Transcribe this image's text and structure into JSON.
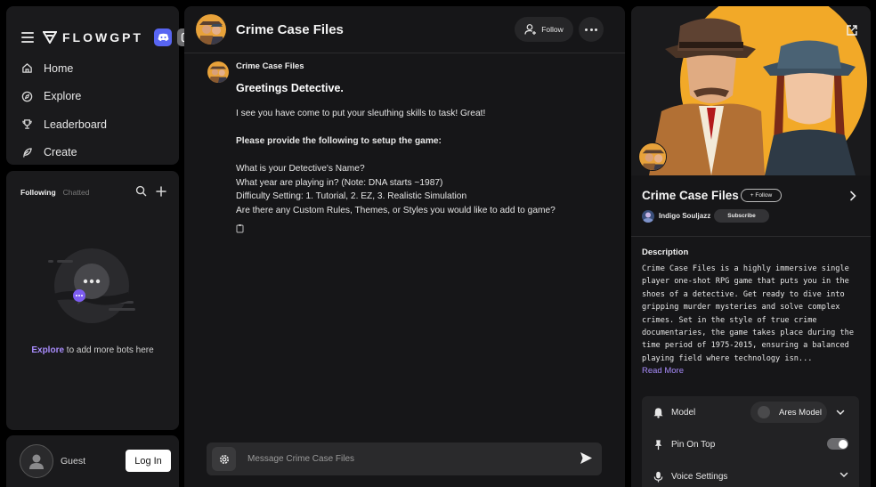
{
  "brand": {
    "name": "FLOWGPT"
  },
  "nav": {
    "items": [
      {
        "label": "Home",
        "icon": "home-icon"
      },
      {
        "label": "Explore",
        "icon": "compass-icon"
      },
      {
        "label": "Leaderboard",
        "icon": "trophy-icon"
      },
      {
        "label": "Create",
        "icon": "feather-icon"
      }
    ]
  },
  "following": {
    "tab_active": "Following",
    "tab_inactive": "Chatted",
    "empty_link": "Explore",
    "empty_text": " to add more bots here"
  },
  "user": {
    "name": "Guest",
    "login_label": "Log In"
  },
  "chat": {
    "title": "Crime Case Files",
    "follow_label": "Follow",
    "message": {
      "author": "Crime Case Files",
      "greeting": "Greetings Detective.",
      "line1": "I see you have come to put your sleuthing skills to task! Great!",
      "line2": "Please provide the following to setup the game:",
      "line3": "What is your Detective's Name?",
      "line4": "What year are playing in? (Note: DNA starts ~1987)",
      "line5": "Difficulty Setting: 1. Tutorial, 2. EZ, 3. Realistic Simulation",
      "line6": "Are there any Custom Rules, Themes, or Styles you would like to add to game?"
    },
    "input_placeholder": "Message Crime Case Files"
  },
  "detail": {
    "bot_name": "Crime Case Files",
    "follow_label": "+ Follow",
    "creator": "Indigo Souljazz",
    "subscribe_label": "Subscribe",
    "description_title": "Description",
    "description": "Crime Case Files is a highly immersive single player one-shot RPG game that puts you in the shoes of a detective. Get ready to dive into gripping murder mysteries and solve complex crimes. Set in the style of true crime documentaries, the game takes place during the time period of 1975-2015, ensuring a balanced playing field where technology isn...",
    "read_more": "Read More",
    "settings": {
      "model_label": "Model",
      "model_value": "Ares Model",
      "pin_label": "Pin On Top",
      "voice_label": "Voice Settings"
    }
  },
  "colors": {
    "accent": "#a78bfa",
    "discord": "#5865f2",
    "panel": "#1a1a1c"
  }
}
